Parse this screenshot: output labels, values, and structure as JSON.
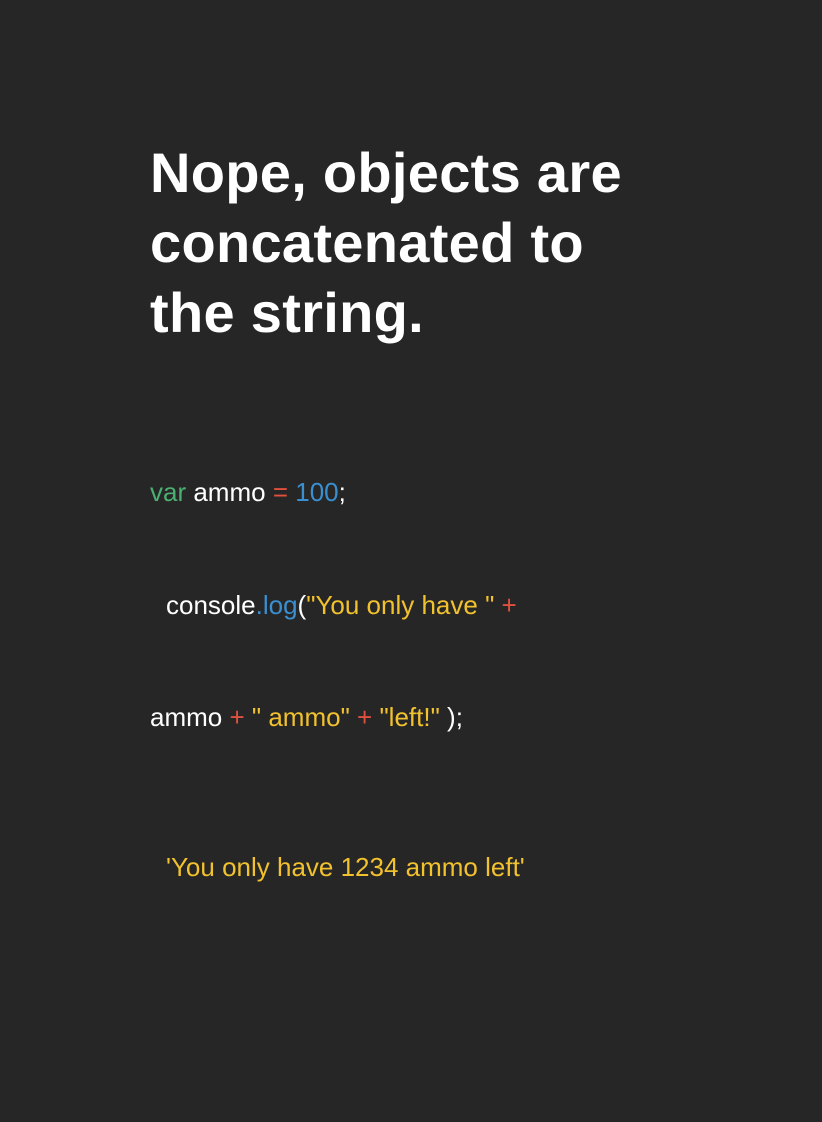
{
  "heading": {
    "lines": [
      "Nope, objects are",
      "concatenated to",
      "the string."
    ]
  },
  "code": {
    "line1": {
      "keyword": "var",
      "ident": " ammo ",
      "op": "=",
      "space": " ",
      "number": "100",
      "end": ";"
    },
    "line2": {
      "obj": "console",
      "method": ".log",
      "paren": "(",
      "string": "\"You only have \"",
      "space": " ",
      "op": "+"
    },
    "line3": {
      "ident": "ammo ",
      "op1": "+",
      "str1": " \" ammo\" ",
      "op2": "+",
      "str2": " \"left!\"",
      "end": " );"
    }
  },
  "output": {
    "text": "'You only have 1234 ammo left'"
  },
  "colors": {
    "background": "#262626",
    "keyword": "#4caf72",
    "operator": "#e0503f",
    "number": "#3a8fd0",
    "string": "#f2c12e",
    "function": "#3a8fd0",
    "plain": "#ffffff"
  }
}
